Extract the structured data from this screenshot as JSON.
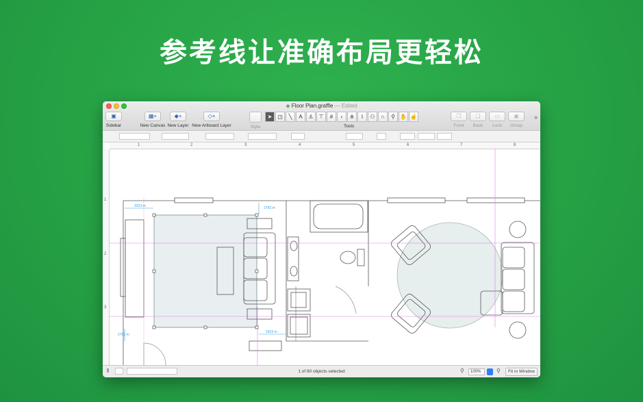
{
  "headline": "参考线让准确布局更轻松",
  "window": {
    "title": "Floor Plan.graffle",
    "edited": "— Edited"
  },
  "toolbar": {
    "sidebar": "Sidebar",
    "new_canvas": "New Canvas",
    "new_layer": "New Layer",
    "new_artboard_layer": "New Artboard Layer",
    "style": "Style",
    "tools": "Tools",
    "front": "Front",
    "back": "Back",
    "lock": "Lock",
    "group": "Group"
  },
  "tool_icons": [
    "pointer-icon",
    "shape-icon",
    "line-icon",
    "text-icon",
    "pen-icon",
    "diagram-icon",
    "grid-icon",
    "chevron-icon",
    "tree-icon",
    "brush-icon",
    "stamp-icon",
    "magnet-icon",
    "zoom-icon",
    "hand-icon",
    "browse-icon"
  ],
  "ruler": {
    "top": [
      "1",
      "2",
      "3",
      "4",
      "5",
      "6",
      "7",
      "8"
    ],
    "left": [
      "1",
      "2",
      "3"
    ]
  },
  "dimensions": {
    "width_top": "3323 m",
    "width_bottom": "3323 m",
    "height_right": "2783 m",
    "height_left": "2783 m"
  },
  "status": {
    "selection": "1 of 80 objects selected",
    "zoom": "100%",
    "fit": "Fit in Window"
  },
  "colors": {
    "background": "#25a044",
    "guide": "#e07be0",
    "selection_fill": "#e9eff1",
    "dimension": "#3aa0e0"
  }
}
